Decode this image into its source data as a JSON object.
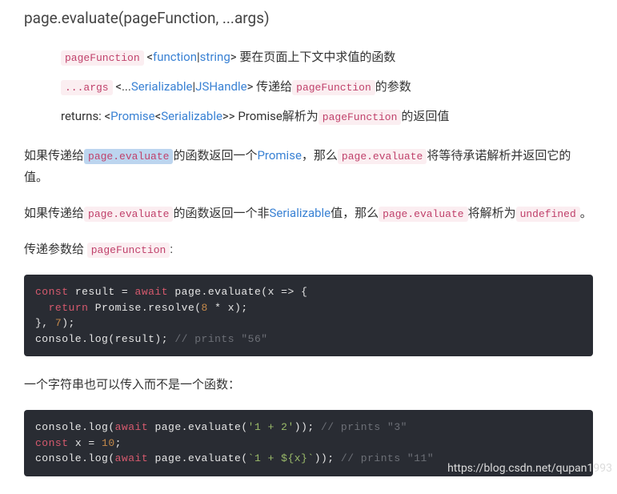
{
  "heading": "page.evaluate(pageFunction, ...args)",
  "params": {
    "p1": {
      "code": "pageFunction",
      "open": " <",
      "t1": "function",
      "pipe": "|",
      "t2": "string",
      "close": "> ",
      "desc": "要在页面上下文中求值的函数"
    },
    "p2": {
      "code": "...args",
      "open": " <...",
      "t1": "Serializable",
      "pipe": "|",
      "t2": "JSHandle",
      "close": "> ",
      "desc_a": "传递给",
      "inner": "pageFunction",
      "desc_b": "的参数"
    },
    "p3": {
      "pre": "returns: <",
      "t1": "Promise",
      "lt": "<",
      "t2": "Serializable",
      "close": ">> ",
      "desc_a": "Promise解析为",
      "inner": "pageFunction",
      "desc_b": "的返回值"
    }
  },
  "para1": {
    "a": "如果传递给",
    "c1": "page.evaluate",
    "b": "的函数返回一个",
    "link": "Promise",
    "c": "，那么",
    "c2": "page.evaluate",
    "d": "将等待承诺解析并返回它的值。"
  },
  "para2": {
    "a": "如果传递给",
    "c1": "page.evaluate",
    "b": "的函数返回一个非",
    "link": "Serializable",
    "c": "值，那么",
    "c2": "page.evaluate",
    "d": "将解析为",
    "c3": "undefined",
    "e": "。"
  },
  "para3": {
    "a": "传递参数给 ",
    "c1": "pageFunction",
    "b": ":"
  },
  "code1": {
    "l1a": "const",
    "l1b": " result = ",
    "l1c": "await",
    "l1d": " page.evaluate(x => {",
    "l2a": "  ",
    "l2b": "return",
    "l2c": " Promise.resolve(",
    "l2d": "8",
    "l2e": " * x);",
    "l3a": "}, ",
    "l3b": "7",
    "l3c": ");",
    "l4a": "console.log(result); ",
    "l4b": "// prints \"56\""
  },
  "para4": "一个字符串也可以传入而不是一个函数：",
  "code2": {
    "l1a": "console.log(",
    "l1b": "await",
    "l1c": " page.evaluate(",
    "l1d": "'1 + 2'",
    "l1e": ")); ",
    "l1f": "// prints \"3\"",
    "l2a": "const",
    "l2b": " x = ",
    "l2c": "10",
    "l2d": ";",
    "l3a": "console.log(",
    "l3b": "await",
    "l3c": " page.evaluate(",
    "l3d": "`1 + ${x}`",
    "l3e": ")); ",
    "l3f": "// prints \"11\""
  },
  "watermark": "https://blog.csdn.net/qupan1993"
}
